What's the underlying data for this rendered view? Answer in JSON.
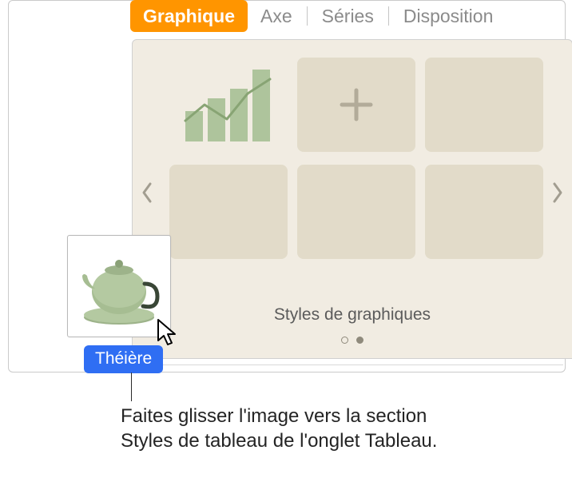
{
  "tabs": {
    "chart": "Graphique",
    "axis": "Axe",
    "series": "Séries",
    "layout": "Disposition"
  },
  "styles": {
    "caption": "Styles de graphiques"
  },
  "drag": {
    "label": "Théière"
  },
  "callout": {
    "text": "Faites glisser l'image vers la section Styles de tableau de l'onglet Tableau."
  }
}
